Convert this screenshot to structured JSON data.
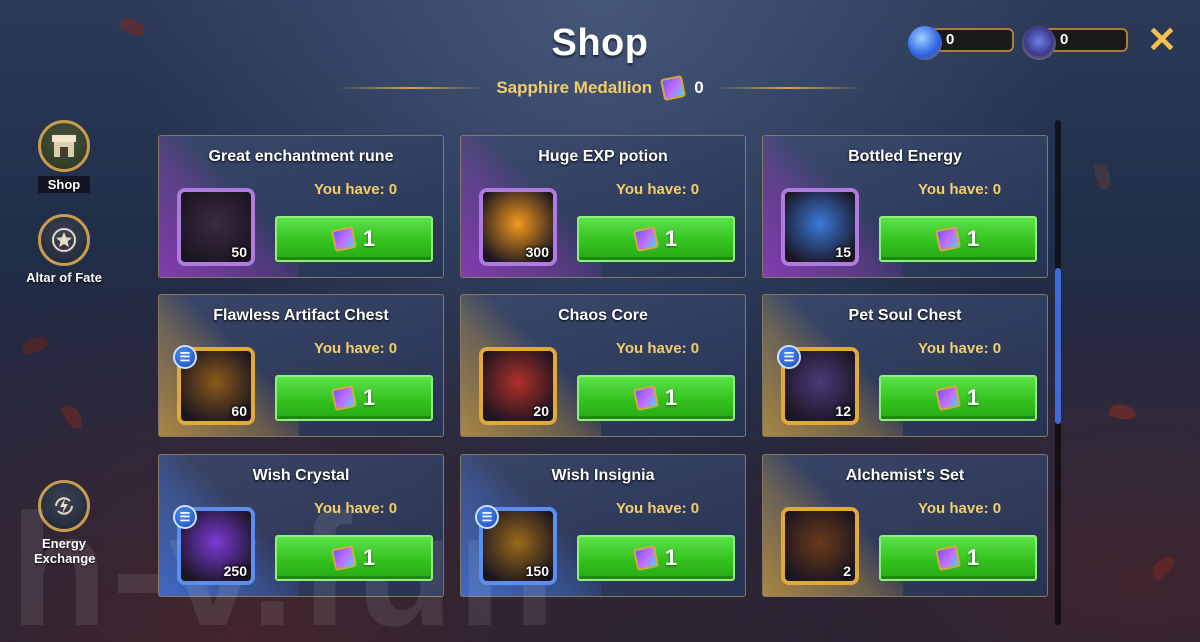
{
  "header": {
    "title": "Shop",
    "currency_name": "Sapphire Medallion",
    "currency_count": "0",
    "currency_icon": "sapphire-medallion-icon"
  },
  "top_counters": [
    {
      "icon": "energy-crystal-icon",
      "value": "0"
    },
    {
      "icon": "fate-emblem-icon",
      "value": "0"
    }
  ],
  "close_icon": "close-icon",
  "sidebar": {
    "items": [
      {
        "label": "Shop",
        "icon": "shop-stall-icon",
        "active": true
      },
      {
        "label": "Altar of Fate",
        "icon": "star-icon",
        "active": false
      },
      {
        "label": "Energy Exchange",
        "icon": "exchange-lightning-icon",
        "active": false
      }
    ]
  },
  "shop": {
    "you_have_label": "You have: 0",
    "items": [
      {
        "name": "Great enchantment rune",
        "quantity": "50",
        "price": "1",
        "rarity": "purple",
        "has_info": false,
        "art_color": "#3a2a40"
      },
      {
        "name": "Huge EXP potion",
        "quantity": "300",
        "price": "1",
        "rarity": "purple",
        "has_info": false,
        "art_color": "#f29a1e"
      },
      {
        "name": "Bottled Energy",
        "quantity": "15",
        "price": "1",
        "rarity": "purple",
        "has_info": false,
        "art_color": "#3a7ad9"
      },
      {
        "name": "Flawless Artifact Chest",
        "quantity": "60",
        "price": "1",
        "rarity": "gold",
        "has_info": true,
        "art_color": "#8a5a1a"
      },
      {
        "name": "Chaos Core",
        "quantity": "20",
        "price": "1",
        "rarity": "gold",
        "has_info": false,
        "art_color": "#b0302a"
      },
      {
        "name": "Pet Soul Chest",
        "quantity": "12",
        "price": "1",
        "rarity": "gold",
        "has_info": true,
        "art_color": "#4a3a7a"
      },
      {
        "name": "Wish Crystal",
        "quantity": "250",
        "price": "1",
        "rarity": "blue",
        "has_info": true,
        "art_color": "#7a3ad9"
      },
      {
        "name": "Wish Insignia",
        "quantity": "150",
        "price": "1",
        "rarity": "blue",
        "has_info": true,
        "art_color": "#9a6a1a"
      },
      {
        "name": "Alchemist's Set",
        "quantity": "2",
        "price": "1",
        "rarity": "gold",
        "has_info": false,
        "art_color": "#6a3a1a"
      }
    ]
  },
  "watermark": "h-v.fun",
  "colors": {
    "accent_gold": "#f2cf6b",
    "buy_green": "#35c21f",
    "close_yellow": "#f2c14e"
  }
}
